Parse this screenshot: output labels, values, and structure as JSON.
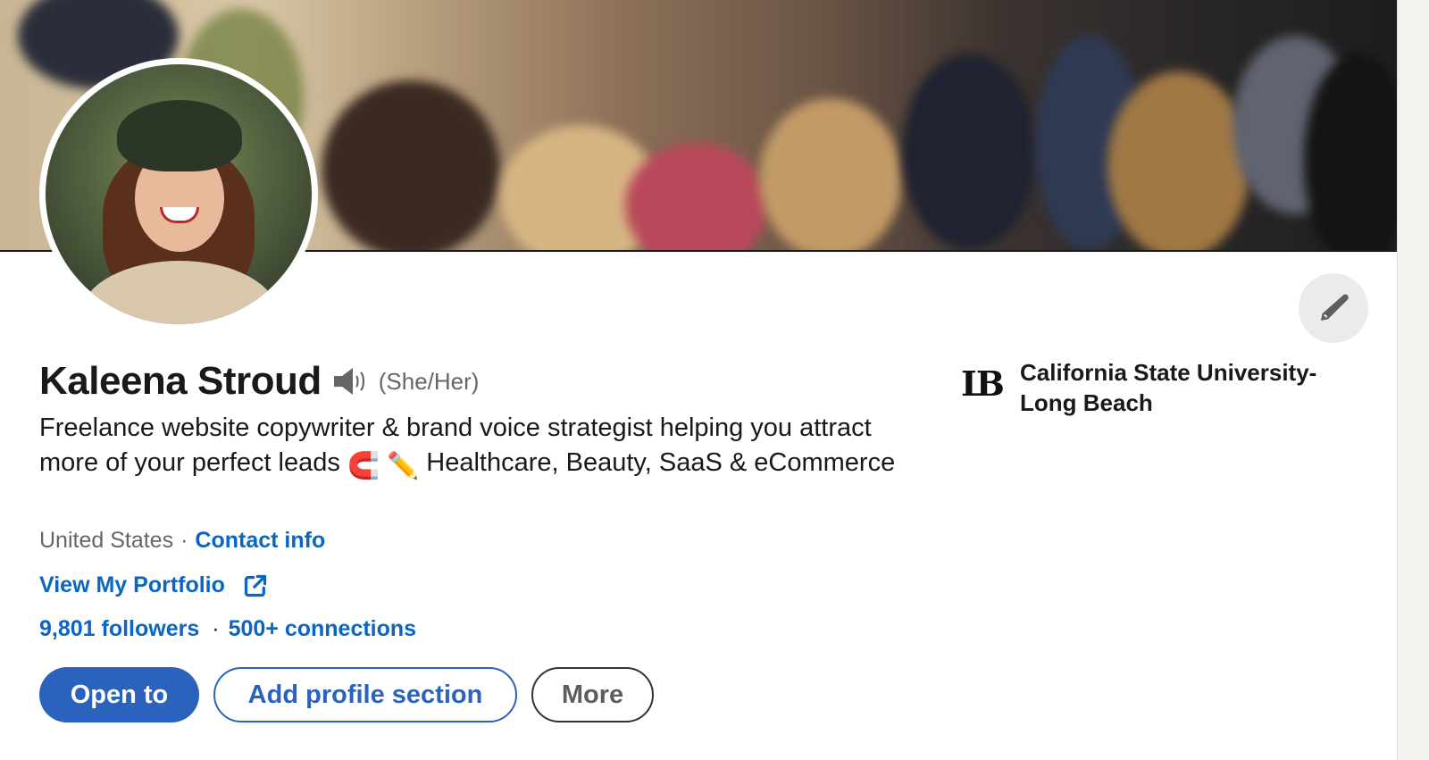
{
  "profile": {
    "name": "Kaleena Stroud",
    "pronouns": "(She/Her)",
    "headline_part1": "Freelance website copywriter & brand voice strategist helping you attract more of your perfect leads ",
    "headline_emoji_magnet": "🧲",
    "headline_emoji_pencil": "✏️",
    "headline_part2": " Healthcare, Beauty, SaaS & eCommerce",
    "location": "United States",
    "separator": "·",
    "contact_info_label": "Contact info",
    "portfolio_label": "View My Portfolio",
    "followers_label": "9,801 followers",
    "connections_label": "500+ connections"
  },
  "icons": {
    "speaker": "speaker-icon",
    "external_link": "external-link-icon",
    "edit": "pencil-icon",
    "school_logo": "csulb-logo"
  },
  "school": {
    "logo_text": "LB",
    "name": "California State University-Long Beach"
  },
  "actions": {
    "open_to_label": "Open to",
    "add_section_label": "Add profile section",
    "more_label": "More"
  },
  "colors": {
    "link_blue": "#0a66c2",
    "primary_button": "#2a62bd",
    "muted_text": "#666666",
    "edit_button_bg": "#ebebeb"
  }
}
